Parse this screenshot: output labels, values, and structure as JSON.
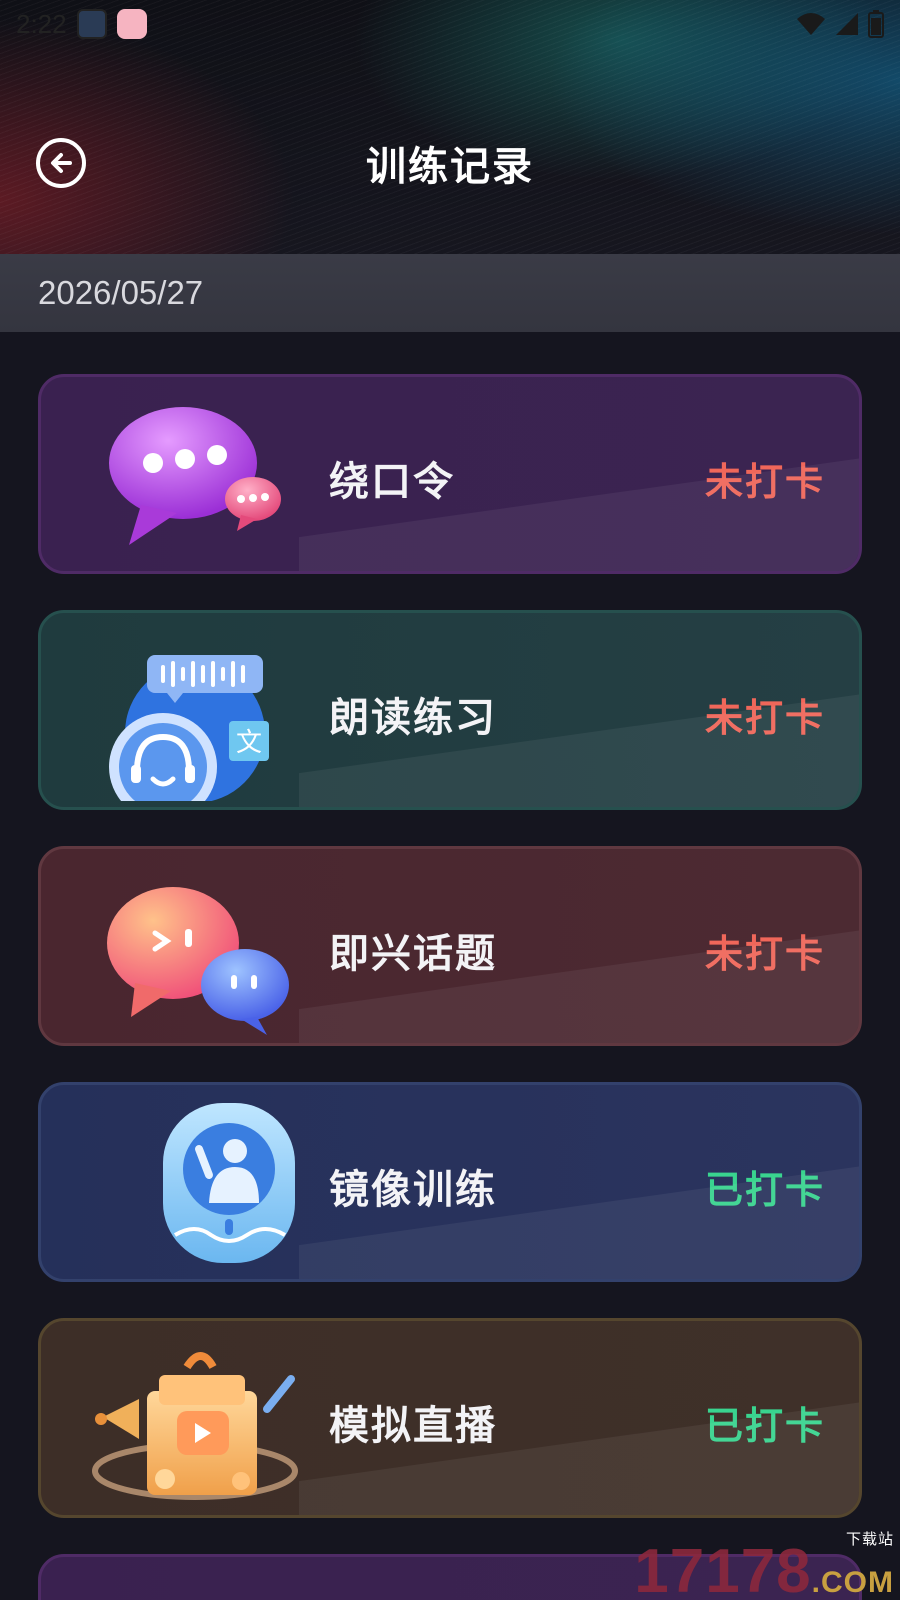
{
  "status_bar": {
    "time": "2:22"
  },
  "header": {
    "title": "训练记录",
    "back_icon": "back-arrow-icon"
  },
  "date_bar": {
    "date": "2026/05/27"
  },
  "records": [
    {
      "name": "绕口令",
      "status": "未打卡",
      "status_color": "#f0675a",
      "icon": "chat-bubbles-icon"
    },
    {
      "name": "朗读练习",
      "status": "未打卡",
      "status_color": "#f0675a",
      "icon": "headset-reading-icon"
    },
    {
      "name": "即兴话题",
      "status": "未打卡",
      "status_color": "#f0675a",
      "icon": "chat-bubble-pair-icon"
    },
    {
      "name": "镜像训练",
      "status": "已打卡",
      "status_color": "#39d48f",
      "icon": "mirror-person-icon"
    },
    {
      "name": "模拟直播",
      "status": "已打卡",
      "status_color": "#39d48f",
      "icon": "live-gift-box-icon"
    }
  ],
  "watermark": {
    "brand": "17178",
    "suffix": ".COM",
    "caption": "下载站"
  }
}
